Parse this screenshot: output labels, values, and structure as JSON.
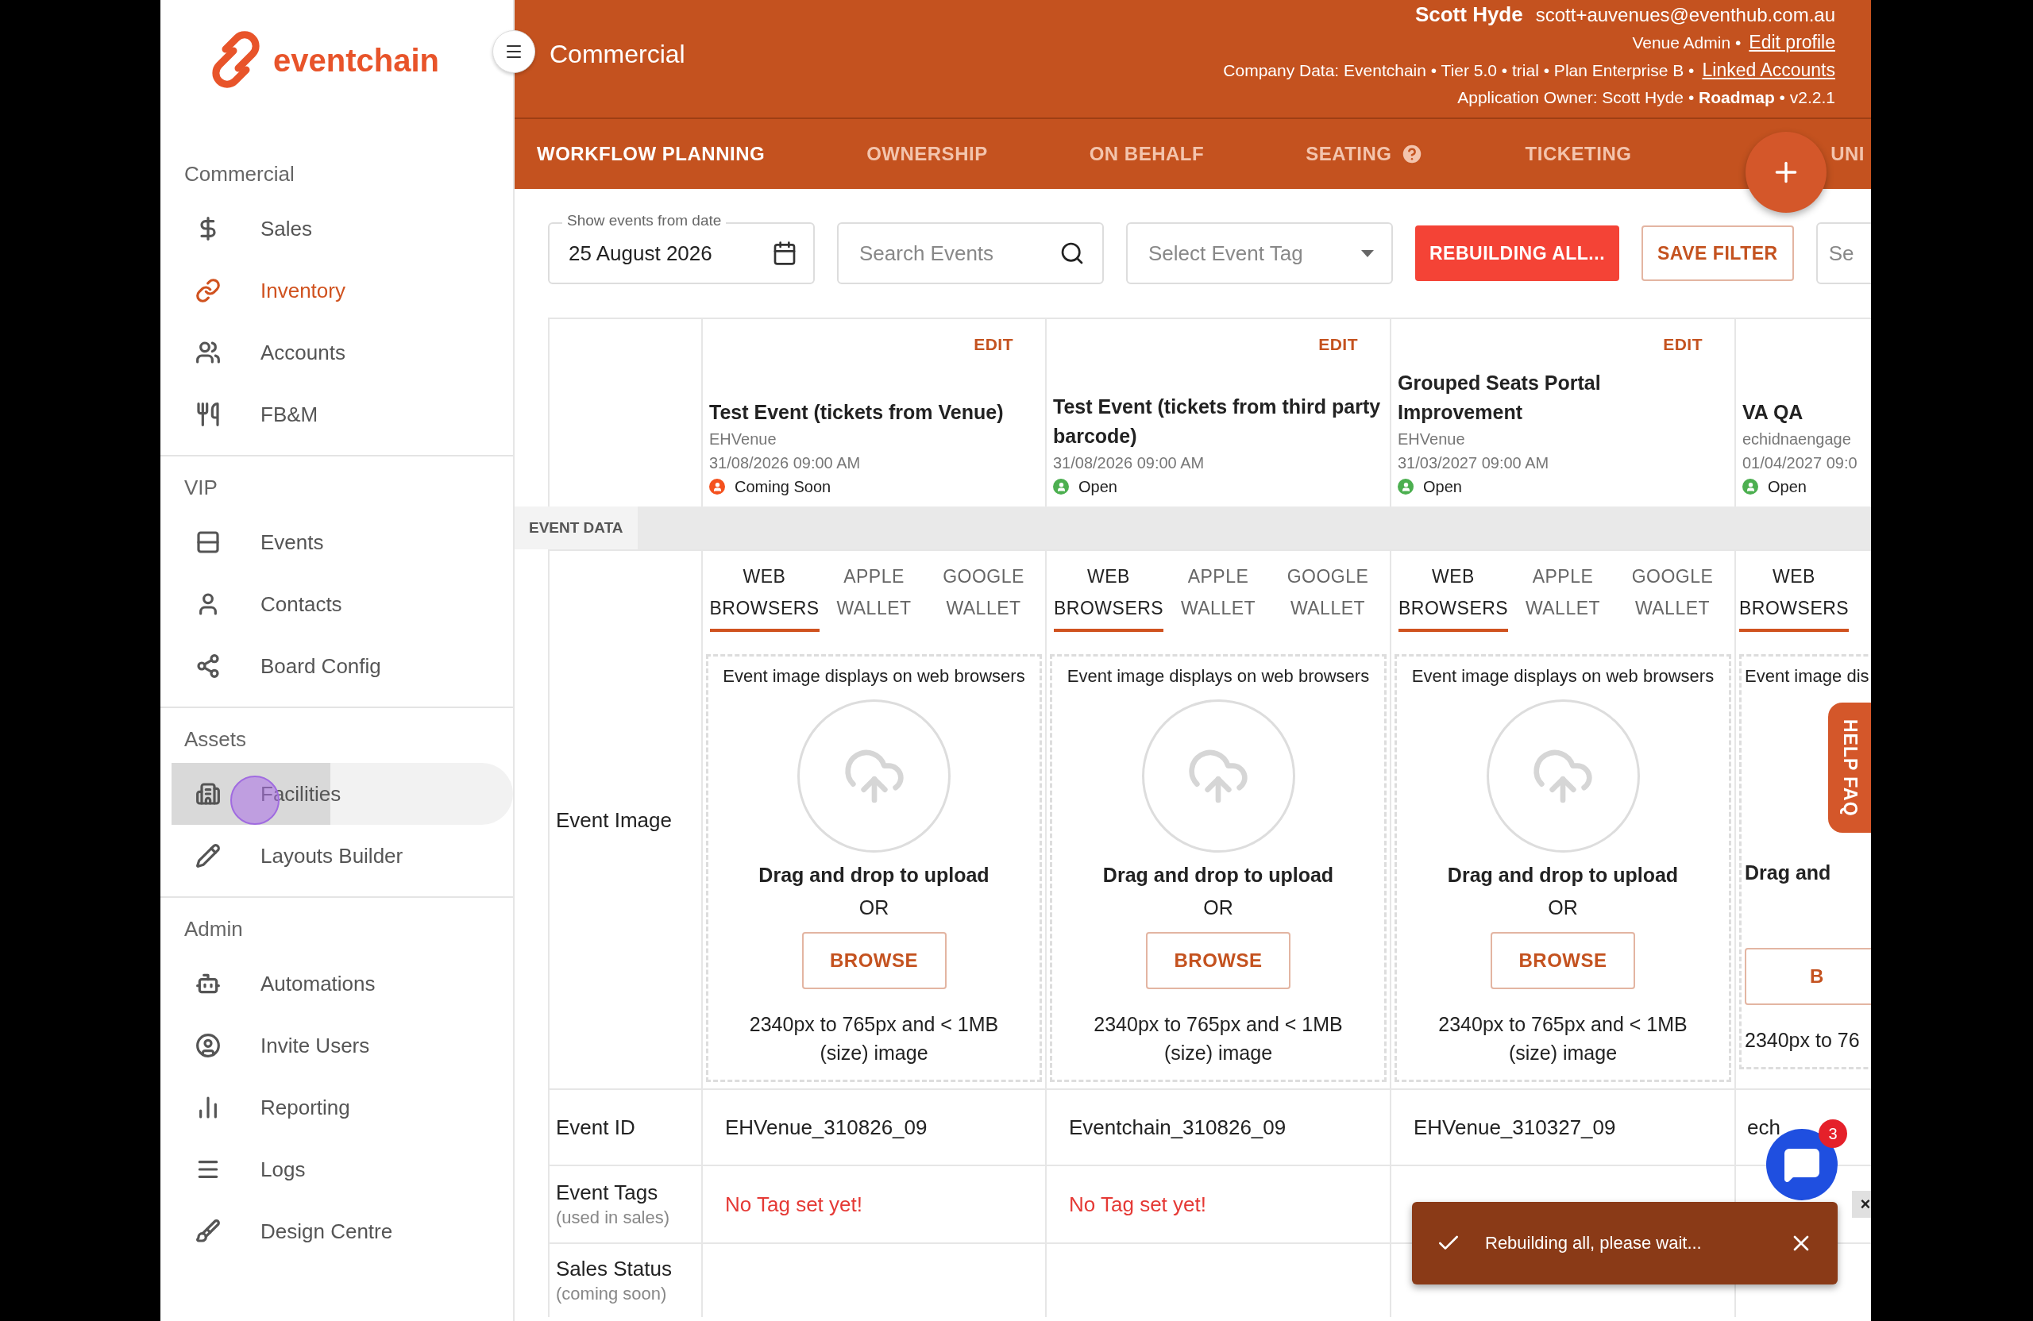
{
  "sidebar": {
    "logo": "eventchain",
    "sections": [
      {
        "title": "Commercial",
        "items": [
          {
            "label": "Sales",
            "selected": false,
            "pressed": false
          },
          {
            "label": "Inventory",
            "selected": true,
            "pressed": false
          },
          {
            "label": "Accounts",
            "selected": false,
            "pressed": false
          },
          {
            "label": "FB&M",
            "selected": false,
            "pressed": false
          }
        ]
      },
      {
        "title": "VIP",
        "items": [
          {
            "label": "Events",
            "selected": false,
            "pressed": false
          },
          {
            "label": "Contacts",
            "selected": false,
            "pressed": false
          },
          {
            "label": "Board Config",
            "selected": false,
            "pressed": false
          }
        ]
      },
      {
        "title": "Assets",
        "items": [
          {
            "label": "Facilities",
            "selected": false,
            "pressed": true
          },
          {
            "label": "Layouts Builder",
            "selected": false,
            "pressed": false
          }
        ]
      },
      {
        "title": "Admin",
        "items": [
          {
            "label": "Automations",
            "selected": false,
            "pressed": false
          },
          {
            "label": "Invite Users",
            "selected": false,
            "pressed": false
          },
          {
            "label": "Reporting",
            "selected": false,
            "pressed": false
          },
          {
            "label": "Logs",
            "selected": false,
            "pressed": false
          },
          {
            "label": "Design Centre",
            "selected": false,
            "pressed": false
          }
        ]
      }
    ]
  },
  "header": {
    "title": "Commercial",
    "user_name": "Scott Hyde",
    "email": "scott+auvenues@eventhub.com.au",
    "role": "Venue Admin •",
    "edit_profile": "Edit profile",
    "company": "Company Data: Eventchain • Tier 5.0 • trial • Plan Enterprise B •",
    "linked_accounts": "Linked Accounts",
    "owner": "Application Owner: Scott Hyde • **Roadmap** • v2.2.1"
  },
  "tabs": [
    {
      "label": "WORKFLOW PLANNING",
      "selected": true,
      "help": false
    },
    {
      "label": "OWNERSHIP",
      "selected": false,
      "help": false
    },
    {
      "label": "ON BEHALF",
      "selected": false,
      "help": false
    },
    {
      "label": "SEATING",
      "selected": false,
      "help": true
    },
    {
      "label": "TICKETING",
      "selected": false,
      "help": false
    },
    {
      "label": "UNI",
      "selected": false,
      "help": false
    }
  ],
  "filters": {
    "date": {
      "label": "Show events from date",
      "value": "25 August 2026"
    },
    "search": {
      "placeholder": "Search Events"
    },
    "tag_select": {
      "placeholder": "Select Event Tag"
    },
    "rebuild_button": "REBUILDING ALL...",
    "save_button": "SAVE FILTER",
    "extra_field": {
      "placeholder": "Se"
    }
  },
  "section_label": "EVENT DATA",
  "row_labels": {
    "image": "Event Image",
    "event_id": "Event ID",
    "tags": "Event Tags",
    "tags_note": "(used in sales)",
    "sales_status": "Sales Status",
    "sales_note": "(coming soon)"
  },
  "events": [
    {
      "kind": "full",
      "edit": "EDIT",
      "title": "Test Event (tickets from Venue)",
      "venue": "EHVenue",
      "date": "31/08/2026 09:00 AM",
      "status": {
        "label": "Coming Soon",
        "color": "#f4511e"
      },
      "image_tabs": [
        {
          "label": "WEB BROWSERS",
          "selected": true
        },
        {
          "label": "APPLE WALLET",
          "selected": false
        },
        {
          "label": "GOOGLE WALLET",
          "selected": false
        }
      ],
      "image_hint": "Event image displays on web browsers",
      "drop_text": "Drag and drop to upload",
      "or_text": "OR",
      "browse": "BROWSE",
      "size_note": "2340px to 765px and < 1MB (size) image",
      "event_id": "EHVenue_310826_09",
      "tags": "No Tag set yet!"
    },
    {
      "kind": "full",
      "edit": "EDIT",
      "title": "Test Event (tickets from third party barcode)",
      "date": "31/08/2026 09:00 AM",
      "status": {
        "label": "Open",
        "color": "#4caf50"
      },
      "image_tabs": [
        {
          "label": "WEB BROWSERS",
          "selected": true
        },
        {
          "label": "APPLE WALLET",
          "selected": false
        },
        {
          "label": "GOOGLE WALLET",
          "selected": false
        }
      ],
      "image_hint": "Event image displays on web browsers",
      "drop_text": "Drag and drop to upload",
      "or_text": "OR",
      "browse": "BROWSE",
      "size_note": "2340px to 765px and < 1MB (size) image",
      "event_id": "Eventchain_310826_09",
      "tags": "No Tag set yet!"
    },
    {
      "kind": "full",
      "edit": "EDIT",
      "title": "Grouped Seats Portal Improvement",
      "venue": "EHVenue",
      "date": "31/03/2027 09:00 AM",
      "status": {
        "label": "Open",
        "color": "#4caf50"
      },
      "image_tabs": [
        {
          "label": "WEB BROWSERS",
          "selected": true
        },
        {
          "label": "APPLE WALLET",
          "selected": false
        },
        {
          "label": "GOOGLE WALLET",
          "selected": false
        }
      ],
      "image_hint": "Event image displays on web browsers",
      "drop_text": "Drag and drop to upload",
      "or_text": "OR",
      "browse": "BROWSE",
      "size_note": "2340px to 765px and < 1MB (size) image",
      "event_id": "EHVenue_310327_09"
    },
    {
      "kind": "clipped",
      "title": "VA QA",
      "venue": "echidnaengage",
      "date": "01/04/2027 09:0",
      "status": {
        "label": "Open",
        "color": "#4caf50"
      },
      "image_tabs": [
        {
          "label": "WEB BROWSERS",
          "selected": true
        }
      ],
      "image_hint": "Event image dis",
      "drop_text": "Drag and",
      "browse": "B",
      "size_note": "2340px to 76",
      "event_id": "ech",
      "tag_remove": "×"
    }
  ],
  "toast": {
    "message": "Rebuilding all, please wait..."
  },
  "chat": {
    "badge": "3"
  },
  "help_tab": "HELP FAQ"
}
